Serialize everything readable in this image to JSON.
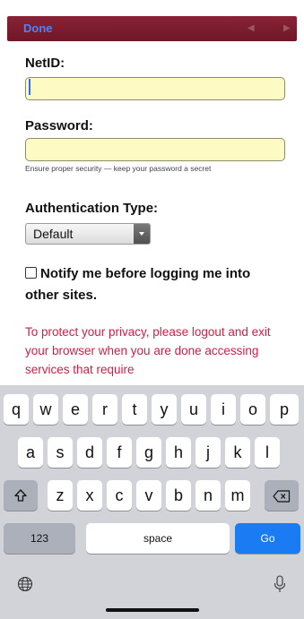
{
  "toolbar": {
    "done_label": "Done",
    "prev_icon": "triangle-left-icon",
    "next_icon": "triangle-right-icon"
  },
  "form": {
    "netid_label": "NetID:",
    "netid_value": "",
    "password_label": "Password:",
    "password_value": "",
    "password_hint": "Ensure proper security — keep your password a secret",
    "auth_type_label": "Authentication Type:",
    "auth_type_selected": "Default",
    "notify_label": "Notify me before logging me into other sites.",
    "privacy_text": "To protect your privacy, please logout and exit your browser when you are done accessing services that require"
  },
  "keyboard": {
    "row1": [
      "q",
      "w",
      "e",
      "r",
      "t",
      "y",
      "u",
      "i",
      "o",
      "p"
    ],
    "row2": [
      "a",
      "s",
      "d",
      "f",
      "g",
      "h",
      "j",
      "k",
      "l"
    ],
    "row3": [
      "z",
      "x",
      "c",
      "v",
      "b",
      "n",
      "m"
    ],
    "shift_icon": "shift-icon",
    "delete_icon": "backspace-icon",
    "numbers_label": "123",
    "space_label": "space",
    "go_label": "Go",
    "globe_icon": "globe-icon",
    "mic_icon": "microphone-icon"
  },
  "colors": {
    "toolbar": "#7a1c2e",
    "done_text": "#4a83ff",
    "input_bg": "#fdfbc3",
    "privacy_text": "#d21e45",
    "go_key": "#1a7bf2",
    "keyboard_bg": "#d1d3d9"
  }
}
